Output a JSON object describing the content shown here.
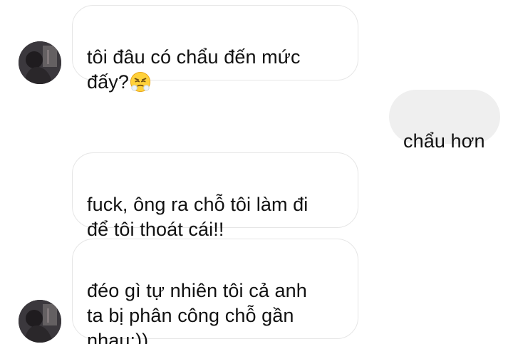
{
  "conversation": {
    "messages": [
      {
        "sender": "other",
        "text": "tôi đâu có chẩu đến mức\nđấy?",
        "emoji": "face-with-steam-from-nose-icon"
      },
      {
        "sender": "me",
        "text": "chẩu hơn"
      },
      {
        "sender": "other",
        "text": "fuck, ông ra chỗ tôi làm đi\nđể tôi thoát cái!!"
      },
      {
        "sender": "other",
        "text": "đéo gì tự nhiên tôi cả anh\nta bị phân công chỗ gần\nnhau:))"
      }
    ]
  },
  "colors": {
    "incoming_bubble": "#ffffff",
    "incoming_border": "#e6e6e6",
    "outgoing_bubble": "#efefef",
    "text": "#111111"
  }
}
